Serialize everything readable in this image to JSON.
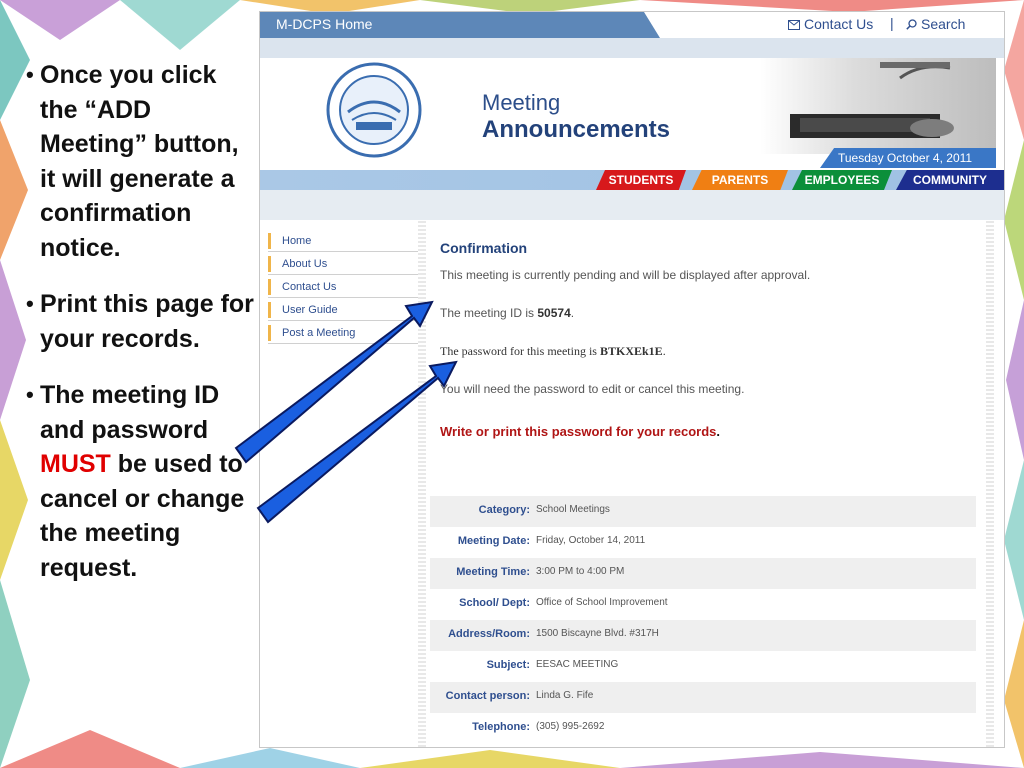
{
  "slide": {
    "bullets": [
      {
        "text": "Once you click the “ADD Meeting” button, it will generate a confirmation notice."
      },
      {
        "text": "Print this page for your records."
      },
      {
        "text_before": "The meeting ID and password ",
        "emphasis": "MUST",
        "text_after": " be used to cancel or change the meeting request."
      }
    ],
    "emphasis_color": "#e00000"
  },
  "site": {
    "home_link": "M-DCPS Home",
    "contact_link": "Contact Us",
    "separator": "|",
    "search_link": "Search",
    "title_line1": "Meeting",
    "title_line2": "Announcements",
    "date": "Tuesday October 4, 2011",
    "nav": [
      "STUDENTS",
      "PARENTS",
      "EMPLOYEES",
      "COMMUNITY"
    ],
    "nav_colors": [
      "#d7191c",
      "#f07f13",
      "#0b8f3a",
      "#1d2e8f"
    ],
    "side_menu": [
      "Home",
      "About Us",
      "Contact Us",
      "User Guide",
      "Post a Meeting"
    ]
  },
  "confirmation": {
    "heading": "Confirmation",
    "pending_text": "This meeting is currently pending and will be displayed after approval.",
    "id_prefix": "The meeting ID is ",
    "meeting_id": "50574",
    "id_suffix": ".",
    "pw_prefix": "The password for this meeting is ",
    "password": "BTKXEk1E",
    "pw_suffix": ".",
    "edit_text": "You will need the password to edit or cancel this meeting.",
    "warning_prefix": "Write or print this password for your records",
    "warning_suffix": "."
  },
  "details": [
    {
      "label": "Category:",
      "value": "School Meetings"
    },
    {
      "label": "Meeting Date:",
      "value": "Friday, October 14, 2011"
    },
    {
      "label": "Meeting Time:",
      "value": "3:00 PM to 4:00 PM"
    },
    {
      "label": "School/ Dept:",
      "value": "Office of School Improvement"
    },
    {
      "label": "Address/Room:",
      "value": "1500 Biscayne Blvd. #317H"
    },
    {
      "label": "Subject:",
      "value": "EESAC MEETING"
    },
    {
      "label": "Contact person:",
      "value": "Linda G. Fife"
    },
    {
      "label": "Telephone:",
      "value": "(305) 995-2692"
    }
  ],
  "icons": {
    "contact": "envelope-icon",
    "search": "magnifier-icon",
    "arrows": "pointer-arrow-icon"
  }
}
